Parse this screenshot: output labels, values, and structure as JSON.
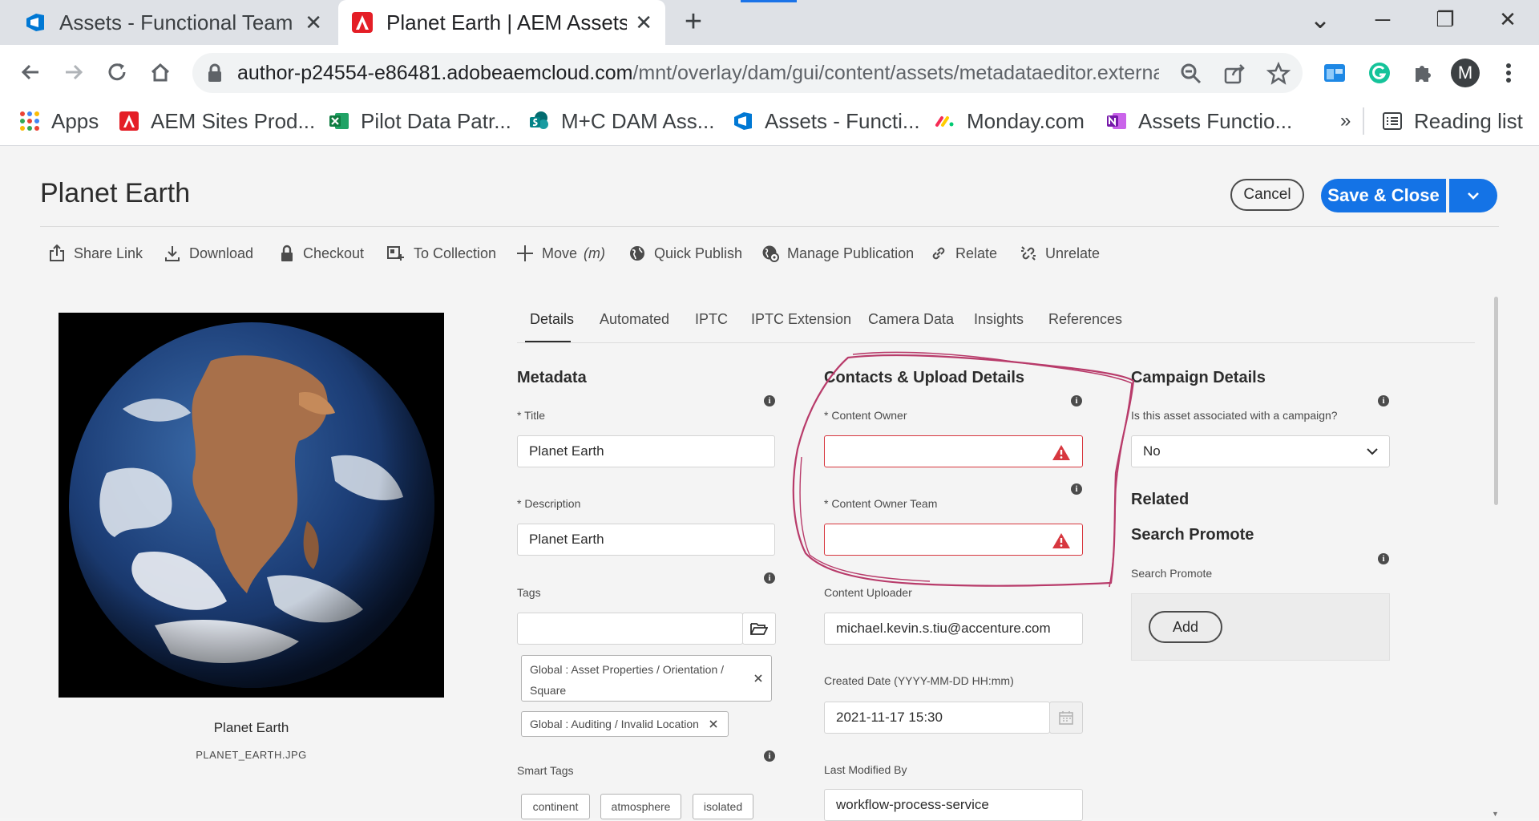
{
  "browser": {
    "tabs": [
      {
        "title": "Assets - Functional Team S",
        "close": "✕"
      },
      {
        "title": "Planet Earth | AEM Assets",
        "close": "✕"
      }
    ],
    "new_tab": "+",
    "window": {
      "minimize": "─",
      "restore": "❐",
      "close": "✕",
      "tab_search": "⌄"
    },
    "url_host": "author-p24554-e86481.adobeaemcloud.com",
    "url_path": "/mnt/overlay/dam/gui/content/assets/metadataeditor.external....",
    "profile_initial": "M",
    "bookmarks": [
      {
        "label": "Apps"
      },
      {
        "label": "AEM Sites Prod..."
      },
      {
        "label": "Pilot Data Patr..."
      },
      {
        "label": "M+C DAM Ass..."
      },
      {
        "label": "Assets - Functi..."
      },
      {
        "label": "Monday.com"
      },
      {
        "label": "Assets Functio..."
      }
    ],
    "more_bookmarks": "»",
    "reading_list": "Reading list"
  },
  "header": {
    "title": "Planet Earth",
    "cancel": "Cancel",
    "save_close": "Save & Close"
  },
  "actions": [
    {
      "label": "Share Link"
    },
    {
      "label": "Download"
    },
    {
      "label": "Checkout"
    },
    {
      "label": "To Collection"
    },
    {
      "label": "Move",
      "shortcut": "(m)"
    },
    {
      "label": "Quick Publish"
    },
    {
      "label": "Manage Publication"
    },
    {
      "label": "Relate"
    },
    {
      "label": "Unrelate"
    }
  ],
  "asset": {
    "name": "Planet Earth",
    "filename": "PLANET_EARTH.JPG"
  },
  "tabs": [
    "Details",
    "Automated",
    "IPTC",
    "IPTC Extension",
    "Camera Data",
    "Insights",
    "References"
  ],
  "metadata": {
    "heading": "Metadata",
    "title_label": "* Title",
    "title_value": "Planet Earth",
    "description_label": "* Description",
    "description_value": "Planet Earth",
    "tags_label": "Tags",
    "tags_value": "",
    "tags": [
      {
        "line1": "Global : Asset Properties / Orientation /",
        "line2": "Square"
      },
      {
        "line1": "Global : Auditing / Invalid Location"
      }
    ],
    "smart_tags_label": "Smart Tags",
    "smart_tags": [
      "continent",
      "atmosphere",
      "isolated"
    ]
  },
  "contacts": {
    "heading": "Contacts & Upload Details",
    "owner_label": "* Content Owner",
    "owner_value": "",
    "owner_team_label": "* Content Owner Team",
    "owner_team_value": "",
    "uploader_label": "Content Uploader",
    "uploader_value": "michael.kevin.s.tiu@accenture.com",
    "created_label": "Created Date (YYYY-MM-DD HH:mm)",
    "created_value": "2021-11-17 15:30",
    "modified_by_label": "Last Modified By",
    "modified_by_value": "workflow-process-service"
  },
  "campaign": {
    "heading": "Campaign Details",
    "question": "Is this asset associated with a campaign?",
    "answer": "No",
    "related_heading": "Related",
    "search_promote_heading": "Search Promote",
    "search_promote_label": "Search Promote",
    "add_button": "Add"
  },
  "colors": {
    "accent": "#1473e6",
    "error": "#d7373f",
    "annotation": "#b83b6a"
  }
}
